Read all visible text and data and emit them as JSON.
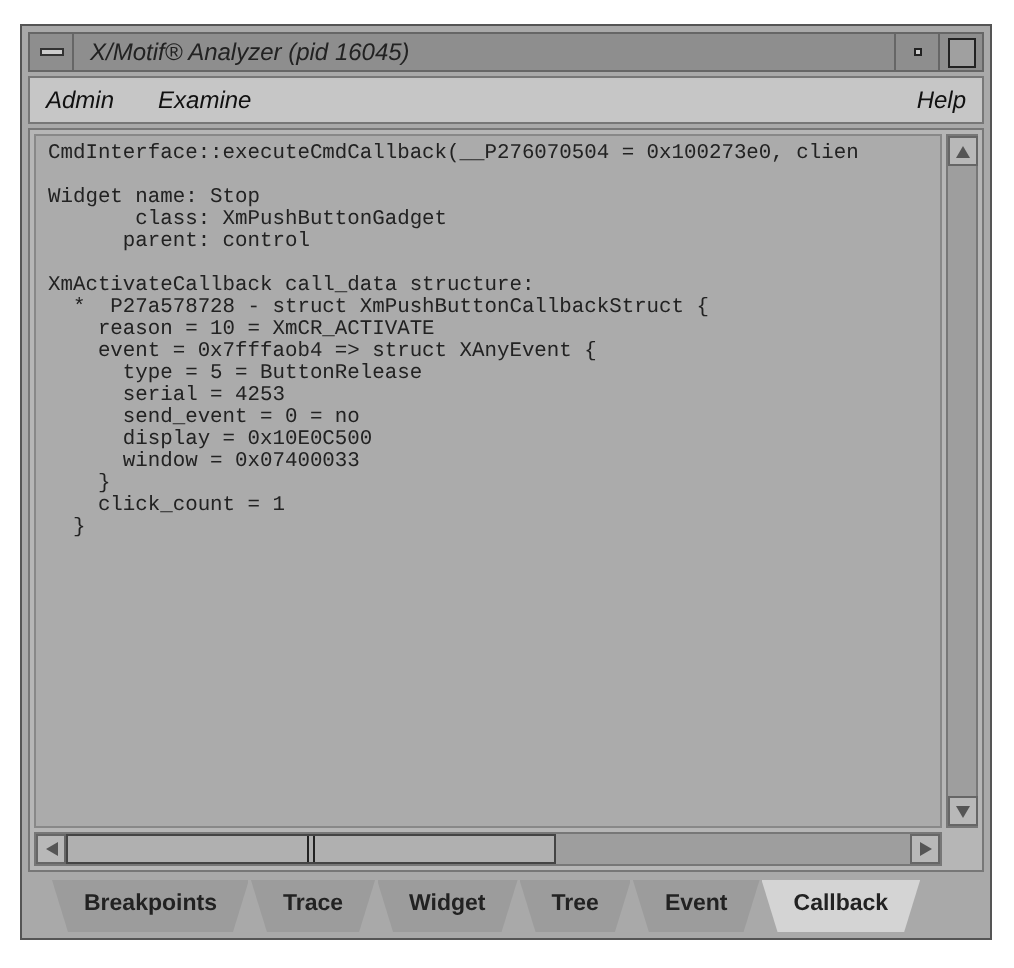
{
  "window": {
    "title": "X/Motif® Analyzer (pid 16045)"
  },
  "menu_left": [
    {
      "label": "Admin"
    },
    {
      "label": "Examine"
    }
  ],
  "menu_right": [
    {
      "label": "Help"
    }
  ],
  "output_blocks": [
    [
      "CmdInterface::executeCmdCallback(__P276070504 = 0x100273e0, clien"
    ],
    [
      "Widget name: Stop",
      "       class: XmPushButtonGadget",
      "      parent: control"
    ],
    [
      "XmActivateCallback call_data structure:",
      "  *  P27a578728 - struct XmPushButtonCallbackStruct {",
      "    reason = 10 = XmCR_ACTIVATE",
      "    event = 0x7fffaob4 => struct XAnyEvent {",
      "      type = 5 = ButtonRelease",
      "      serial = 4253",
      "      send_event = 0 = no",
      "      display = 0x10E0C500",
      "      window = 0x07400033",
      "    }",
      "    click_count = 1",
      "  }"
    ]
  ],
  "tabs": [
    {
      "label": "Breakpoints",
      "selected": false
    },
    {
      "label": "Trace",
      "selected": false
    },
    {
      "label": "Widget",
      "selected": false
    },
    {
      "label": "Tree",
      "selected": false
    },
    {
      "label": "Event",
      "selected": false
    },
    {
      "label": "Callback",
      "selected": true
    }
  ]
}
